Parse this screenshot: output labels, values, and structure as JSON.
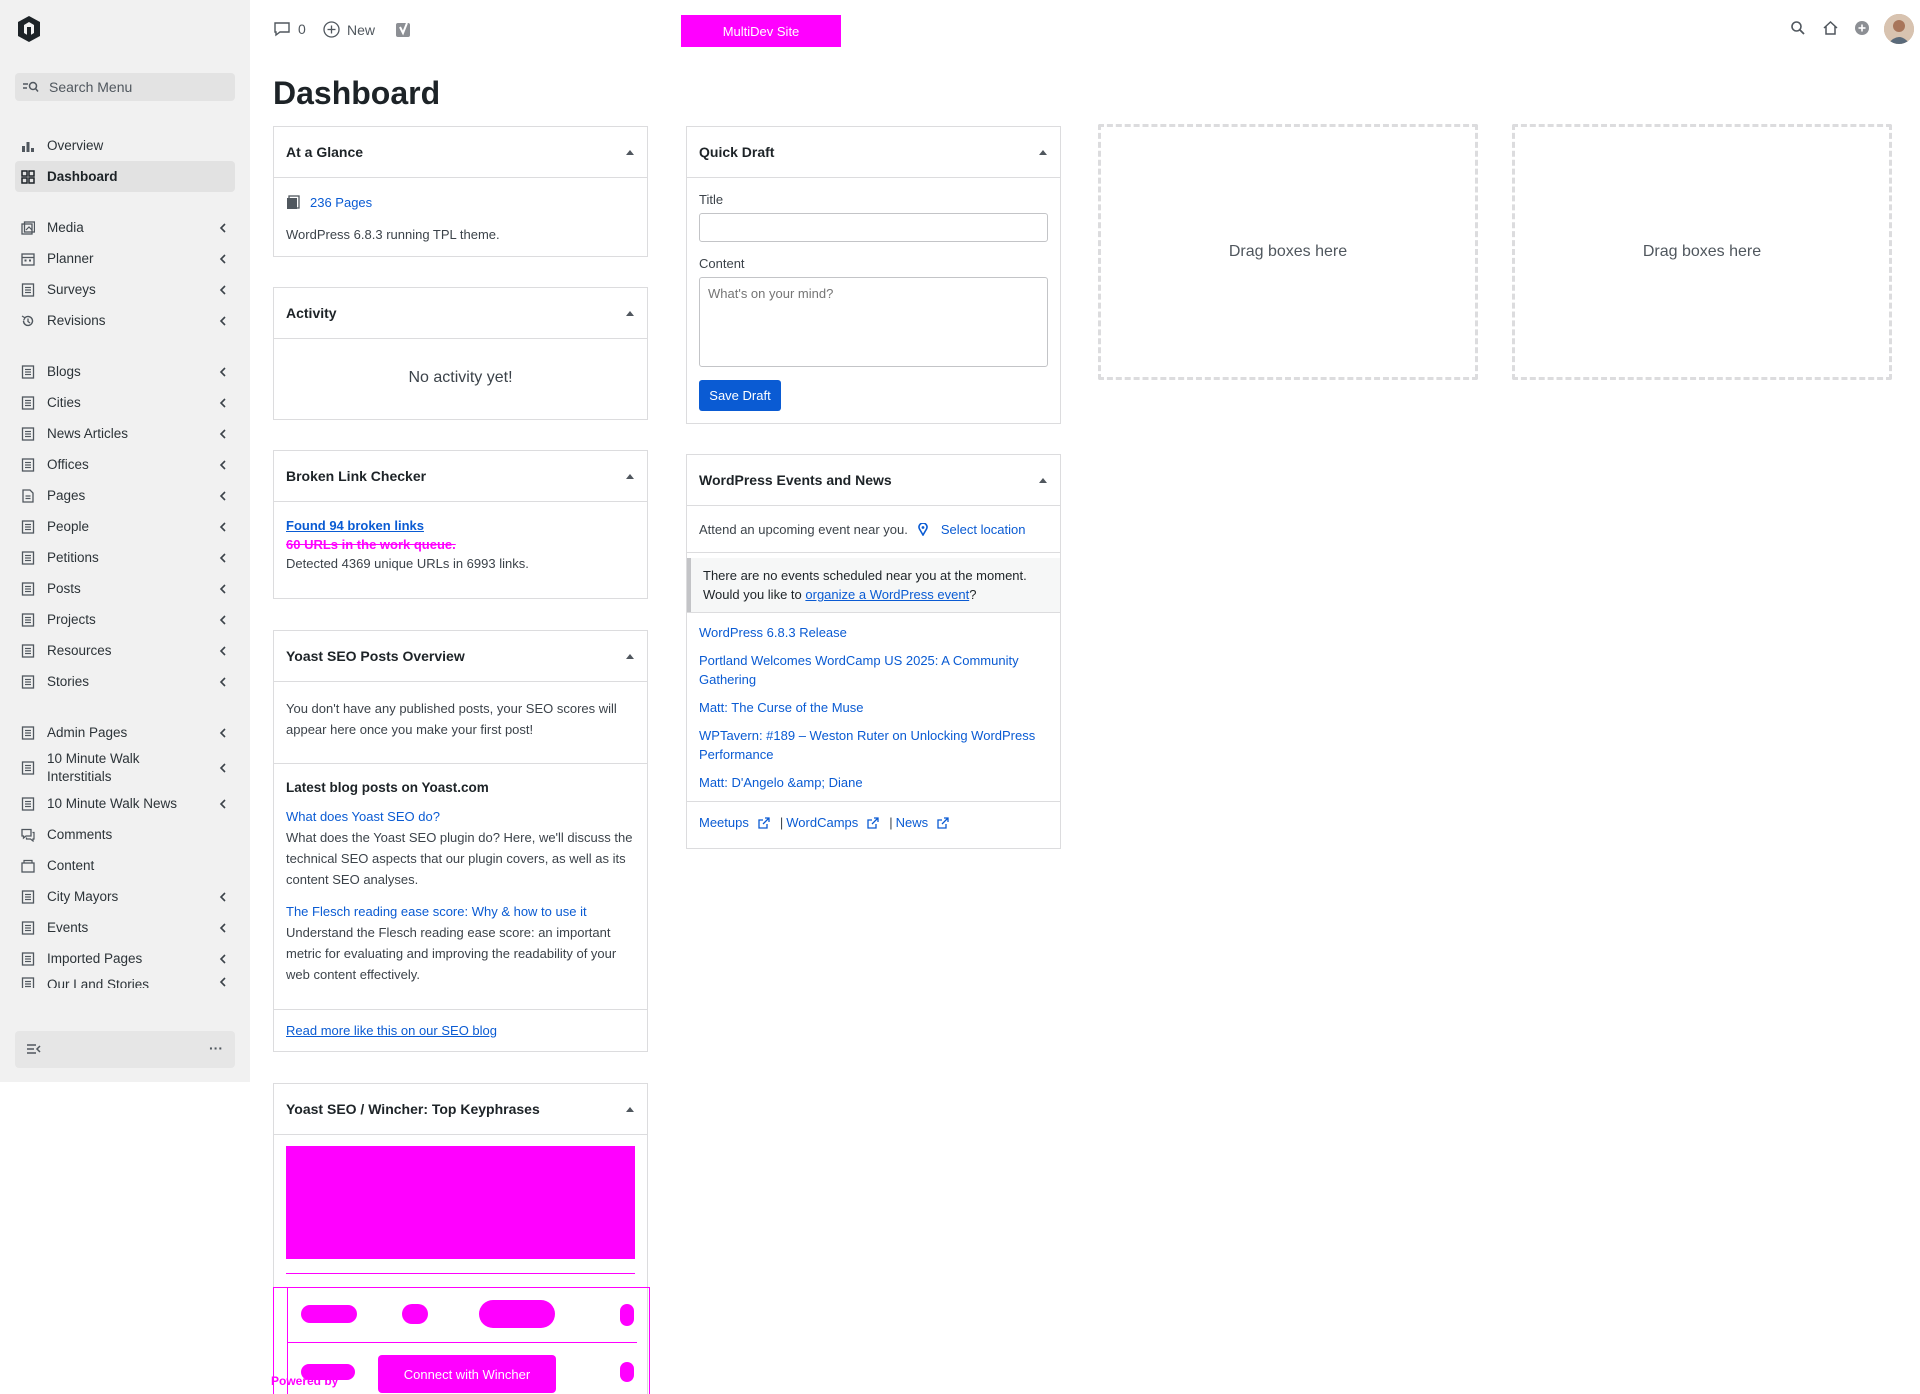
{
  "sidebar": {
    "search_placeholder": "Search Menu",
    "items": [
      {
        "label": "Overview",
        "icon": "bar-chart-icon"
      },
      {
        "label": "Dashboard",
        "icon": "grid-icon",
        "active": true
      },
      {
        "label": "Media",
        "icon": "media-icon"
      },
      {
        "label": "Planner",
        "icon": "calendar-icon"
      },
      {
        "label": "Surveys",
        "icon": "document-icon"
      },
      {
        "label": "Revisions",
        "icon": "history-icon"
      },
      {
        "label": "Blogs",
        "icon": "document-icon"
      },
      {
        "label": "Cities",
        "icon": "document-icon"
      },
      {
        "label": "News Articles",
        "icon": "document-icon"
      },
      {
        "label": "Offices",
        "icon": "document-icon"
      },
      {
        "label": "Pages",
        "icon": "page-icon"
      },
      {
        "label": "People",
        "icon": "document-icon"
      },
      {
        "label": "Petitions",
        "icon": "document-icon"
      },
      {
        "label": "Posts",
        "icon": "document-icon"
      },
      {
        "label": "Projects",
        "icon": "document-icon"
      },
      {
        "label": "Resources",
        "icon": "document-icon"
      },
      {
        "label": "Stories",
        "icon": "document-icon"
      },
      {
        "label": "Admin Pages",
        "icon": "document-icon"
      },
      {
        "label": "10 Minute Walk Interstitials",
        "icon": "document-icon"
      },
      {
        "label": "10 Minute Walk News",
        "icon": "document-icon"
      },
      {
        "label": "Comments",
        "icon": "comments-icon"
      },
      {
        "label": "Content",
        "icon": "content-icon"
      },
      {
        "label": "City Mayors",
        "icon": "document-icon"
      },
      {
        "label": "Events",
        "icon": "document-icon"
      },
      {
        "label": "Imported Pages",
        "icon": "document-icon"
      },
      {
        "label": "Our Land Stories",
        "icon": "document-icon"
      }
    ],
    "footer_more": "···"
  },
  "topbar": {
    "comments_count": "0",
    "new_label": "New",
    "env_badge": "MultiDev Site"
  },
  "page_title": "Dashboard",
  "at_a_glance": {
    "title": "At a Glance",
    "pages_link": "236 Pages",
    "version_text": "WordPress 6.8.3 running TPL theme."
  },
  "activity": {
    "title": "Activity",
    "empty": "No activity yet!"
  },
  "broken_links": {
    "title": "Broken Link Checker",
    "found_link": "Found 94 broken links",
    "queue": "60 URLs in the work queue.",
    "detected": "Detected 4369 unique URLs in 6993 links."
  },
  "yoast_overview": {
    "title": "Yoast SEO Posts Overview",
    "message": "You don't have any published posts, your SEO scores will appear here once you make your first post!",
    "latest_heading": "Latest blog posts on Yoast.com",
    "post1_title": "What does Yoast SEO do?",
    "post1_desc": "What does the Yoast SEO plugin do? Here, we'll discuss the technical SEO aspects that our plugin covers, as well as its content SEO analyses.",
    "post2_title": "The Flesch reading ease score: Why & how to use it",
    "post2_desc": "Understand the Flesch reading ease score: an important metric for evaluating and improving the readability of your web content effectively.",
    "read_more": "Read more like this on our SEO blog"
  },
  "wincher": {
    "title": "Yoast SEO / Wincher: Top Keyphrases",
    "connect_button": "Connect with Wincher",
    "powered_by": "Powered by"
  },
  "quick_draft": {
    "title": "Quick Draft",
    "title_label": "Title",
    "title_value": "",
    "content_label": "Content",
    "content_placeholder": "What's on your mind?",
    "save_button": "Save Draft"
  },
  "events": {
    "title": "WordPress Events and News",
    "attend_text": "Attend an upcoming event near you.",
    "select_location": "Select location",
    "notice_line1": "There are no events scheduled near you at the moment.",
    "notice_line2_pre": "Would you like to",
    "notice_link": "organize a WordPress event",
    "notice_line2_post": "?",
    "news": [
      "WordPress 6.8.3 Release",
      "Portland Welcomes WordCamp US 2025: A Community Gathering",
      "Matt: The Curse of the Muse",
      "WPTavern: #189 – Weston Ruter on Unlocking WordPress Performance",
      "Matt: D'Angelo &amp; Diane"
    ],
    "footer_links": [
      "Meetups",
      "WordCamps",
      "News"
    ]
  },
  "dropzones": {
    "label1": "Drag boxes here",
    "label2": "Drag boxes here"
  },
  "colors": {
    "accent": "#0a5bd3",
    "redaction": "#ff00ff",
    "sidebar_bg": "#f1f1f1"
  }
}
